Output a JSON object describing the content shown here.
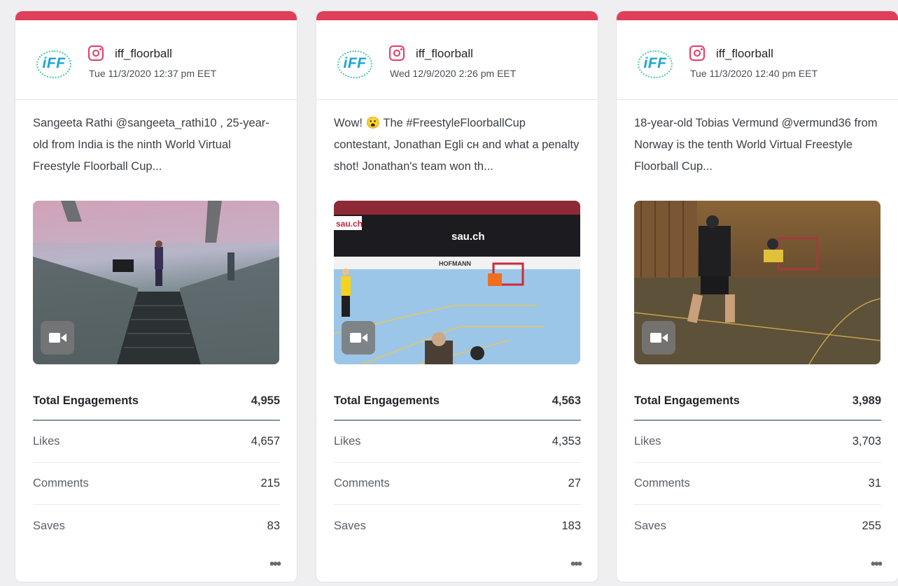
{
  "posts": [
    {
      "handle": "iff_floorball",
      "date": "Tue 11/3/2020 12:37 pm EET",
      "text": "Sangeeta Rathi @sangeeta_rathi10 , 25-year-old from India is the ninth World Virtual Freestyle Floorball Cup...",
      "stats": {
        "total_label": "Total Engagements",
        "total": "4,955",
        "likes_label": "Likes",
        "likes": "4,657",
        "comments_label": "Comments",
        "comments": "215",
        "saves_label": "Saves",
        "saves": "83"
      }
    },
    {
      "handle": "iff_floorball",
      "date": "Wed 12/9/2020 2:26 pm EET",
      "text": "Wow! 😮 The #FreestyleFloorballCup contestant, Jonathan Egli ᴄʜ and what a penalty shot! Jonathan's team won th...",
      "stats": {
        "total_label": "Total Engagements",
        "total": "4,563",
        "likes_label": "Likes",
        "likes": "4,353",
        "comments_label": "Comments",
        "comments": "27",
        "saves_label": "Saves",
        "saves": "183"
      }
    },
    {
      "handle": "iff_floorball",
      "date": "Tue 11/3/2020 12:40 pm EET",
      "text": "18-year-old Tobias Vermund @vermund36 from Norway is the tenth World Virtual Freestyle Floorball Cup...",
      "stats": {
        "total_label": "Total Engagements",
        "total": "3,989",
        "likes_label": "Likes",
        "likes": "3,703",
        "comments_label": "Comments",
        "comments": "31",
        "saves_label": "Saves",
        "saves": "255"
      }
    }
  ],
  "logo_text": "iFF",
  "more_label": "•••",
  "colors": {
    "accent_bar": "#df3f5b",
    "instagram": "#e33b62",
    "divider": "#7b9893",
    "logo": "#1aa6d4"
  },
  "icons": {
    "network": "instagram-icon",
    "media_type": "video-camera-icon",
    "menu": "more-options-icon"
  },
  "media_sign_text": "sau.ch",
  "media_banner_text": "HOFMANN"
}
